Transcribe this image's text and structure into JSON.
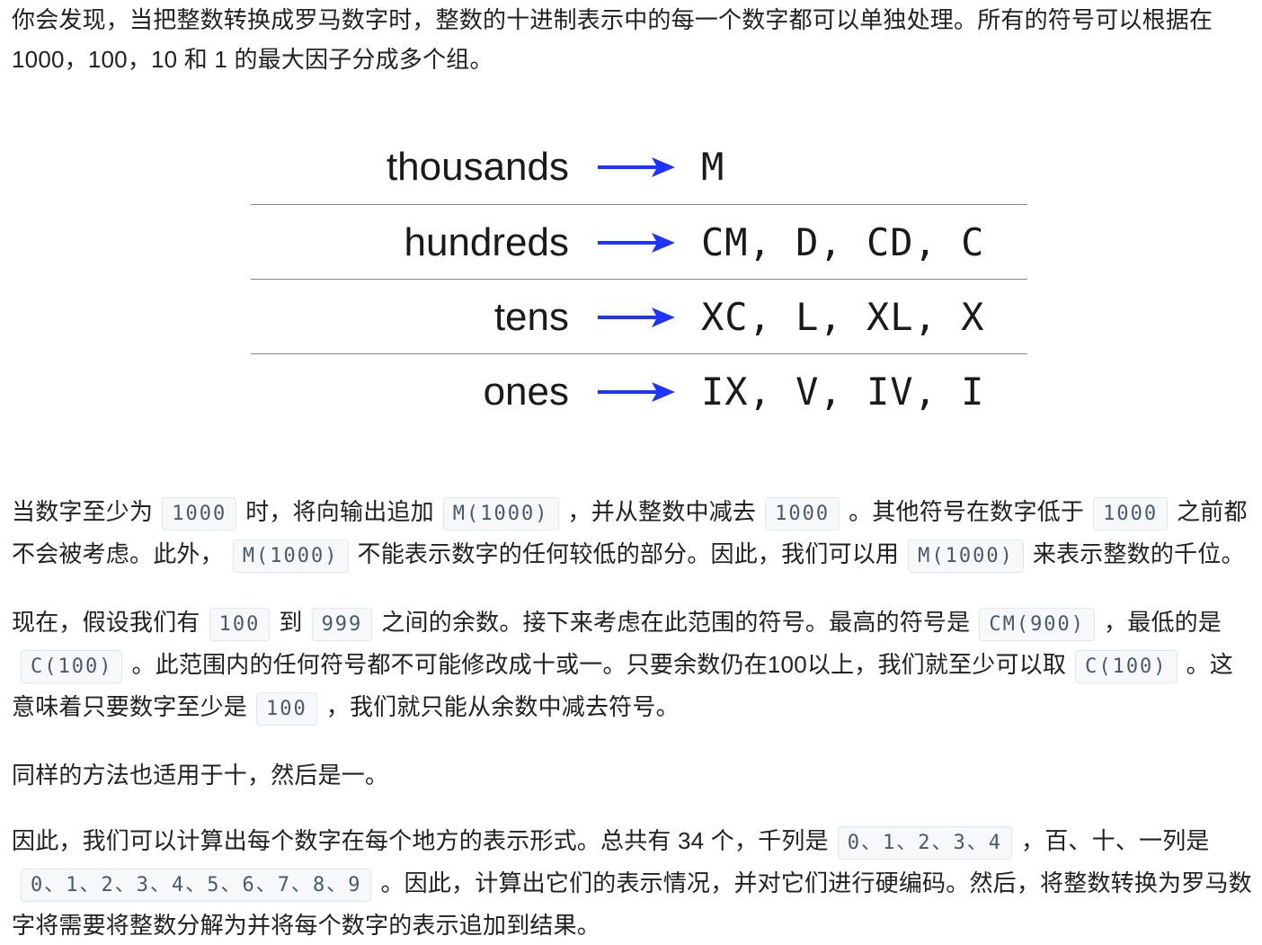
{
  "para1": "你会发现，当把整数转换成罗马数字时，整数的十进制表示中的每一个数字都可以单独处理。所有的符号可以根据在 1000，100，10 和 1 的最大因子分成多个组。",
  "figure": {
    "rows": [
      {
        "label": "thousands",
        "symbols": "M"
      },
      {
        "label": "hundreds",
        "symbols": "CM, D, CD, C"
      },
      {
        "label": "tens",
        "symbols": "XC, L, XL, X"
      },
      {
        "label": "ones",
        "symbols": "IX, V, IV, I"
      }
    ],
    "arrow_color": "#1f35ff"
  },
  "para2": {
    "t1": "当数字至少为",
    "c1": "1000",
    "t2": "时，将向输出追加",
    "c2": "M(1000)",
    "t3": "，并从整数中减去",
    "c3": "1000",
    "t4": "。其他符号在数字低于",
    "c4": "1000",
    "t5": "之前都不会被考虑。此外，",
    "c5": "M(1000)",
    "t6": "不能表示数字的任何较低的部分。因此，我们可以用",
    "c6": "M(1000)",
    "t7": "来表示整数的千位。"
  },
  "para3": {
    "t1": "现在，假设我们有",
    "c1": "100",
    "t2": "到",
    "c2": "999",
    "t3": "之间的余数。接下来考虑在此范围的符号。最高的符号是",
    "c3": "CM(900)",
    "t4": "，最低的是",
    "c4": "C(100)",
    "t5": "。此范围内的任何符号都不可能修改成十或一。只要余数仍在100以上，我们就至少可以取",
    "c5": "C(100)",
    "t6": "。这意味着只要数字至少是",
    "c6": "100",
    "t7": "，我们就只能从余数中减去符号。"
  },
  "para4": "同样的方法也适用于十，然后是一。",
  "para5": {
    "t1": "因此，我们可以计算出每个数字在每个地方的表示形式。总共有 34 个，千列是",
    "c1": "0、1、2、3、4",
    "t2": "，百、十、一列是",
    "c2": "0、1、2、3、4、5、6、7、8、9",
    "t3": "。因此，计算出它们的表示情况，并对它们进行硬编码。然后，将整数转换为罗马数字将需要将整数分解为并将每个数字的表示追加到结果。"
  }
}
